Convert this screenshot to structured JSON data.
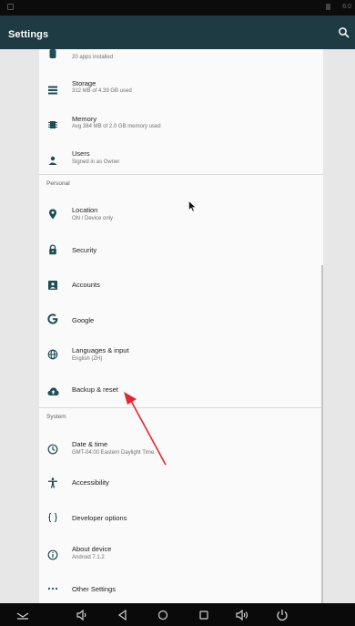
{
  "status_bar": {
    "time": "6:0"
  },
  "app_bar": {
    "title": "Settings"
  },
  "items_top": [
    {
      "title": "",
      "subtitle": "20 apps installed",
      "icon": "apps-icon"
    },
    {
      "title": "Storage",
      "subtitle": "312 MB of 4.39 GB used",
      "icon": "storage-icon"
    },
    {
      "title": "Memory",
      "subtitle": "Avg 384 MB of 2.0 GB memory used",
      "icon": "memory-icon"
    },
    {
      "title": "Users",
      "subtitle": "Signed in as Owner",
      "icon": "person-icon"
    }
  ],
  "section_personal": "Personal",
  "personal": [
    {
      "title": "Location",
      "subtitle": "ON / Device only",
      "icon": "location-icon"
    },
    {
      "title": "Security",
      "subtitle": "",
      "icon": "lock-icon"
    },
    {
      "title": "Accounts",
      "subtitle": "",
      "icon": "accounts-icon"
    },
    {
      "title": "Google",
      "subtitle": "",
      "icon": "google-icon"
    },
    {
      "title": "Languages & input",
      "subtitle": "English (ZH)",
      "icon": "globe-icon"
    },
    {
      "title": "Backup & reset",
      "subtitle": "",
      "icon": "cloud-upload-icon"
    }
  ],
  "section_system": "System",
  "system": [
    {
      "title": "Date & time",
      "subtitle": "GMT-04:00 Eastern Daylight Time",
      "icon": "clock-icon"
    },
    {
      "title": "Accessibility",
      "subtitle": "",
      "icon": "accessibility-icon"
    },
    {
      "title": "Developer options",
      "subtitle": "",
      "icon": "code-braces-icon"
    },
    {
      "title": "About device",
      "subtitle": "Android 7.1.2",
      "icon": "info-icon"
    },
    {
      "title": "Other Settings",
      "subtitle": "",
      "icon": "more-dots-icon"
    }
  ],
  "colors": {
    "app_bar": "#1e3a42",
    "icon_teal": "#1e4d55",
    "annotation_arrow": "#e3262f"
  }
}
